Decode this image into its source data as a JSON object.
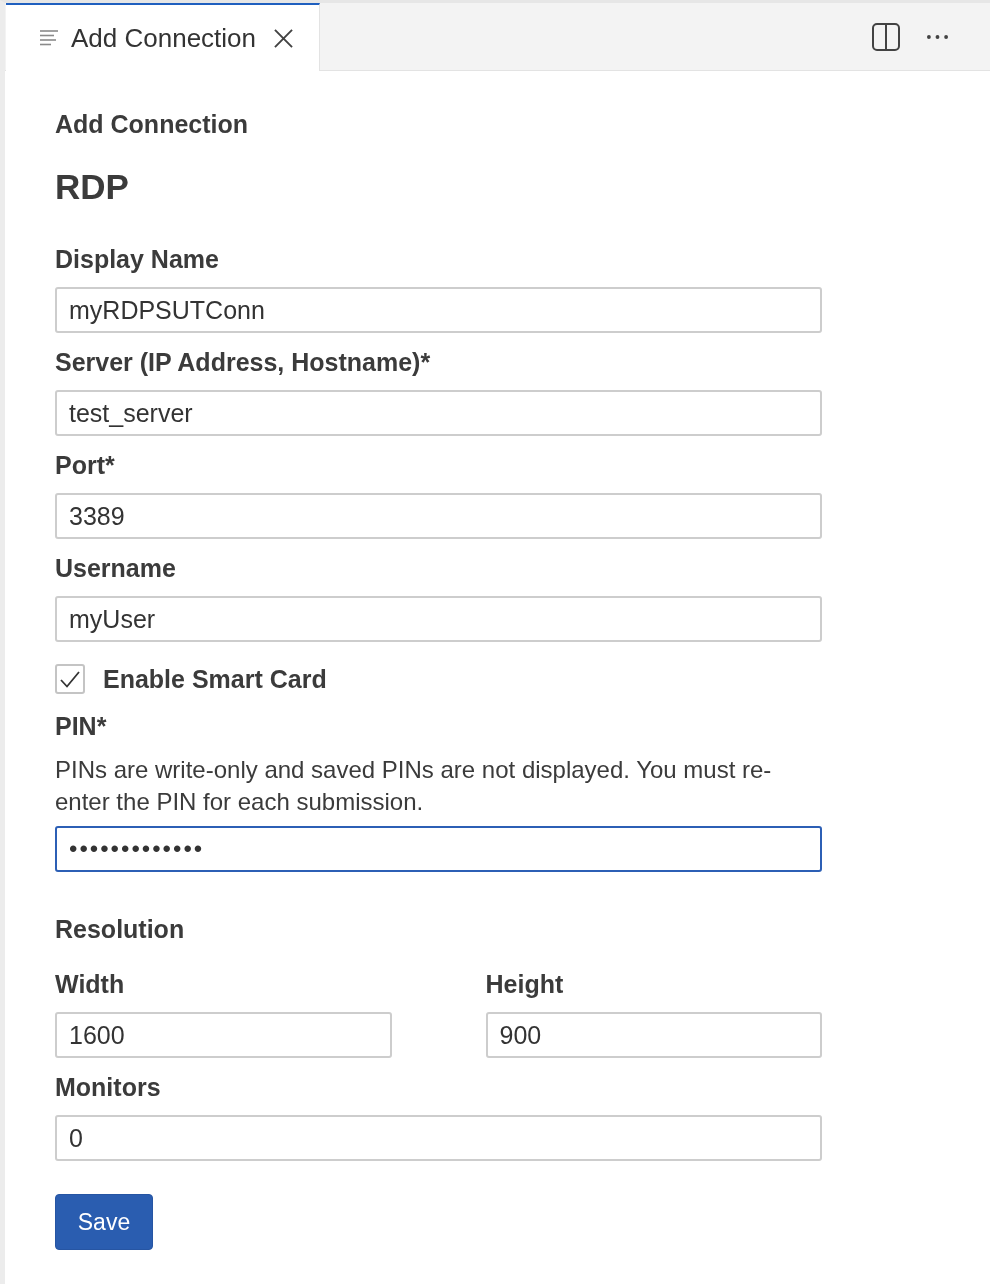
{
  "tabs": [
    {
      "label": "Add Connection",
      "selected": true
    }
  ],
  "form": {
    "heading": "Add Connection",
    "protocol": "RDP",
    "items": [
      {
        "kind": "text",
        "label": "Display Name",
        "value": "myRDPSUTConn",
        "focused": false
      },
      {
        "kind": "text",
        "label": "Server (IP Address, Hostname)*",
        "value": "test_server",
        "focused": false
      },
      {
        "kind": "text",
        "label": "Port*",
        "value": "3389",
        "focused": false
      },
      {
        "kind": "text",
        "label": "Username",
        "value": "myUser",
        "focused": false
      },
      {
        "kind": "checkbox",
        "label": "Enable Smart Card",
        "checked": true
      },
      {
        "kind": "password",
        "label": "PIN*",
        "help": "PINs are write-only and saved PINs are not displayed. You must re-enter the PIN for each submission.",
        "value": "•••••••••••••",
        "focused": true
      },
      {
        "kind": "section",
        "label": "Resolution"
      },
      {
        "kind": "pair",
        "fields": [
          {
            "label": "Width",
            "value": "1600",
            "focused": false
          },
          {
            "label": "Height",
            "value": "900",
            "focused": false
          }
        ]
      },
      {
        "kind": "text",
        "label": "Monitors",
        "value": "0",
        "focused": false
      }
    ],
    "submit": "Save"
  }
}
